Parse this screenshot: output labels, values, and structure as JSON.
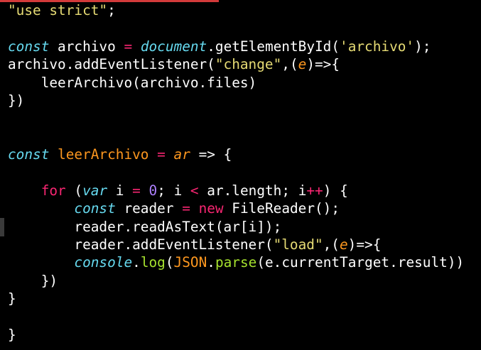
{
  "colors": {
    "background": "#000000",
    "text": "#ffffff",
    "string": "#e6db74",
    "keyword": "#66d9ef",
    "control": "#f92672",
    "function": "#fd971f",
    "accent": "#d23a3a"
  },
  "lines": [
    [
      {
        "t": "\"use strict\"",
        "k": "string"
      },
      {
        "t": ";",
        "k": "text"
      }
    ],
    [],
    [
      {
        "t": "const",
        "k": "keyword"
      },
      {
        "t": " archivo ",
        "k": "text"
      },
      {
        "t": "=",
        "k": "operator"
      },
      {
        "t": " ",
        "k": "text"
      },
      {
        "t": "document",
        "k": "builtin"
      },
      {
        "t": ".getElementById(",
        "k": "text"
      },
      {
        "t": "'archivo'",
        "k": "string"
      },
      {
        "t": ");",
        "k": "text"
      }
    ],
    [
      {
        "t": "archivo.addEventListener(",
        "k": "text"
      },
      {
        "t": "\"change\"",
        "k": "string"
      },
      {
        "t": ",(",
        "k": "text"
      },
      {
        "t": "e",
        "k": "param"
      },
      {
        "t": ")=>{",
        "k": "text"
      }
    ],
    [
      {
        "t": "    leerArchivo(archivo.files)",
        "k": "text"
      }
    ],
    [
      {
        "t": "})",
        "k": "text"
      }
    ],
    [],
    [],
    [
      {
        "t": "const",
        "k": "keyword"
      },
      {
        "t": " ",
        "k": "text"
      },
      {
        "t": "leerArchivo",
        "k": "function"
      },
      {
        "t": " ",
        "k": "text"
      },
      {
        "t": "=",
        "k": "operator"
      },
      {
        "t": " ",
        "k": "text"
      },
      {
        "t": "ar",
        "k": "param"
      },
      {
        "t": " => {",
        "k": "text"
      }
    ],
    [],
    [
      {
        "t": "    ",
        "k": "text"
      },
      {
        "t": "for",
        "k": "control"
      },
      {
        "t": " (",
        "k": "text"
      },
      {
        "t": "var",
        "k": "keyword"
      },
      {
        "t": " i ",
        "k": "text"
      },
      {
        "t": "=",
        "k": "operator"
      },
      {
        "t": " ",
        "k": "text"
      },
      {
        "t": "0",
        "k": "number"
      },
      {
        "t": "; i ",
        "k": "text"
      },
      {
        "t": "<",
        "k": "operator"
      },
      {
        "t": " ar.length; i",
        "k": "text"
      },
      {
        "t": "++",
        "k": "operator"
      },
      {
        "t": ") {",
        "k": "text"
      }
    ],
    [
      {
        "t": "        ",
        "k": "text"
      },
      {
        "t": "const",
        "k": "keyword"
      },
      {
        "t": " reader ",
        "k": "text"
      },
      {
        "t": "=",
        "k": "operator"
      },
      {
        "t": " ",
        "k": "text"
      },
      {
        "t": "new",
        "k": "control"
      },
      {
        "t": " FileReader();",
        "k": "text"
      }
    ],
    [
      {
        "t": "        reader.readAsText(ar[i]);",
        "k": "text"
      }
    ],
    [
      {
        "t": "        reader.addEventListener(",
        "k": "text"
      },
      {
        "t": "\"load\"",
        "k": "string"
      },
      {
        "t": ",(",
        "k": "text"
      },
      {
        "t": "e",
        "k": "param"
      },
      {
        "t": ")=>{",
        "k": "text"
      }
    ],
    [
      {
        "t": "        ",
        "k": "text"
      },
      {
        "t": "console",
        "k": "builtin"
      },
      {
        "t": ".",
        "k": "text"
      },
      {
        "t": "log",
        "k": "method"
      },
      {
        "t": "(",
        "k": "text"
      },
      {
        "t": "JSON",
        "k": "function"
      },
      {
        "t": ".",
        "k": "text"
      },
      {
        "t": "parse",
        "k": "method"
      },
      {
        "t": "(e.currentTarget.result))",
        "k": "text"
      }
    ],
    [
      {
        "t": "    })",
        "k": "text"
      }
    ],
    [
      {
        "t": "}",
        "k": "text"
      }
    ],
    [],
    [
      {
        "t": "}",
        "k": "text"
      }
    ]
  ]
}
